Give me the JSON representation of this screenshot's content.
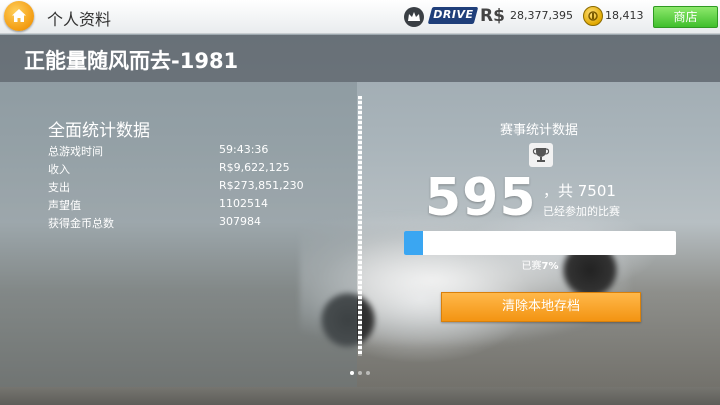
{
  "topbar": {
    "title": "个人资料",
    "currency_label": "R$",
    "rs_balance": "28,377,395",
    "gold_balance": "18,413",
    "shop_label": "商店",
    "drive_logo_text": "DRIVE"
  },
  "profile": {
    "name": "正能量随风而去-1981"
  },
  "overall_stats": {
    "title": "全面统计数据",
    "rows": [
      {
        "label": "总游戏时间",
        "value": "59:43:36"
      },
      {
        "label": "收入",
        "value": "R$9,622,125"
      },
      {
        "label": "支出",
        "value": "R$273,851,230"
      },
      {
        "label": "声望值",
        "value": "1102514"
      },
      {
        "label": "获得金币总数",
        "value": "307984"
      }
    ]
  },
  "race_stats": {
    "title": "赛事统计数据",
    "count": "595",
    "total_text": "，共 7501",
    "participated_label": "已经参加的比赛",
    "progress_prefix": "已赛",
    "progress_percent_text": "7%",
    "progress_fraction": 0.07
  },
  "actions": {
    "clear_save_label": "清除本地存档"
  },
  "pagination": {
    "total": 3,
    "active_index": 0
  },
  "colors": {
    "progress_fill": "#3aa6f2",
    "clear_button": "#f39412",
    "shop_button": "#3fbf2c"
  }
}
